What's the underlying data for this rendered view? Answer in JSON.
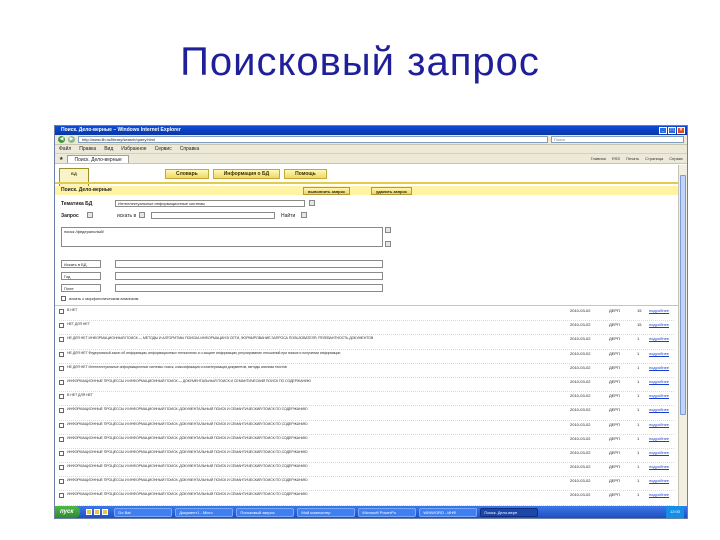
{
  "slide_title": "Поисковый запрос",
  "browser": {
    "title": "Поиск. Дело-верные – Windows Internet Explorer",
    "address": "http://www.lib.ru/library/search/query.html",
    "search_placeholder": "Поиск",
    "menu": [
      "Файл",
      "Правка",
      "Вид",
      "Избранное",
      "Сервис",
      "Справка"
    ],
    "tab_label": "Поиск. Дело-верные",
    "fav_tools": [
      "Главная",
      "RSS",
      "Печать",
      "Страница",
      "Сервис"
    ]
  },
  "site": {
    "logo_text": "БД",
    "nav": [
      "Словарь",
      "Информация о БД",
      "Помощь"
    ],
    "query_title": "Поиск. Дело-верные",
    "btn_run": "выполнить запрос",
    "btn_clear": "удалить запрос",
    "label_theme": "Тематика БД",
    "theme_value": "Интеллектуальные информационные системы",
    "label_query": "Запрос",
    "label_near": "искать в",
    "label_count": "Найти",
    "query_text": "поиск /федеральный/",
    "filters": [
      "Искать в БД",
      "Год",
      "Поле"
    ],
    "morph_label": "искать с морфологическим анализом"
  },
  "results": [
    {
      "text": "В НЕТ",
      "date": "2010-03-02",
      "code": "ДЕРП",
      "num": "15",
      "link": "подробнее"
    },
    {
      "text": "НЕТ ДЛЯ НЕТ",
      "date": "2010-03-02",
      "code": "ДЕРП",
      "num": "15",
      "link": "подробнее"
    },
    {
      "text": "НЕ ДЛЯ НЕТ ИНФОРМАЦИОННЫЙ ПОИСК — МЕТОДЫ И АЛГОРИТМЫ ПОИСКА ИНФОРМАЦИИ В СЕТИ, ФОРМИРОВАНИЕ ЗАПРОСА ПОЛЬЗОВАТЕЛЯ, РЕЛЕВАНТНОСТЬ ДОКУМЕНТОВ",
      "date": "2010-03-02",
      "code": "ДЕРП",
      "num": "1",
      "link": "подробнее"
    },
    {
      "text": "НЕ ДЛЯ НЕТ Федеральный закон об информации, информационных технологиях и о защите информации; регулирование отношений при поиске и получении информации",
      "date": "2010-03-02",
      "code": "ДЕРП",
      "num": "1",
      "link": "подробнее"
    },
    {
      "text": "НЕ ДЛЯ НЕТ Интеллектуальные информационные системы: поиск, классификация и кластеризация документов, методы анализа текстов",
      "date": "2010-03-02",
      "code": "ДЕРП",
      "num": "1",
      "link": "подробнее"
    },
    {
      "text": "ИНФОРМАЦИОННЫЕ ПРОЦЕССЫ И ИНФОРМАЦИОННЫЙ ПОИСК — ДОКУМЕНТАЛЬНЫЙ ПОИСК И СЕМАНТИЧЕСКИЙ ПОИСК ПО СОДЕРЖАНИЮ",
      "date": "2010-03-02",
      "code": "ДЕРП",
      "num": "1",
      "link": "подробнее"
    },
    {
      "text": "В НЕТ ДЛЯ НЕТ",
      "date": "2010-03-02",
      "code": "ДЕРП",
      "num": "1",
      "link": "подробнее"
    },
    {
      "text": "ИНФОРМАЦИОННЫЕ ПРОЦЕССЫ И ИНФОРМАЦИОННЫЙ ПОИСК: ДОКУМЕНТАЛЬНЫЙ ПОИСК И СЕМАНТИЧЕСКИЙ ПОИСК ПО СОДЕРЖАНИЮ",
      "date": "2010-03-02",
      "code": "ДЕРП",
      "num": "1",
      "link": "подробнее"
    },
    {
      "text": "ИНФОРМАЦИОННЫЕ ПРОЦЕССЫ И ИНФОРМАЦИОННЫЙ ПОИСК: ДОКУМЕНТАЛЬНЫЙ ПОИСК И СЕМАНТИЧЕСКИЙ ПОИСК ПО СОДЕРЖАНИЮ",
      "date": "2010-03-02",
      "code": "ДЕРП",
      "num": "1",
      "link": "подробнее"
    },
    {
      "text": "ИНФОРМАЦИОННЫЕ ПРОЦЕССЫ И ИНФОРМАЦИОННЫЙ ПОИСК: ДОКУМЕНТАЛЬНЫЙ ПОИСК И СЕМАНТИЧЕСКИЙ ПОИСК ПО СОДЕРЖАНИЮ",
      "date": "2010-03-02",
      "code": "ДЕРП",
      "num": "1",
      "link": "подробнее"
    },
    {
      "text": "ИНФОРМАЦИОННЫЕ ПРОЦЕССЫ И ИНФОРМАЦИОННЫЙ ПОИСК: ДОКУМЕНТАЛЬНЫЙ ПОИСК И СЕМАНТИЧЕСКИЙ ПОИСК ПО СОДЕРЖАНИЮ",
      "date": "2010-03-02",
      "code": "ДЕРП",
      "num": "1",
      "link": "подробнее"
    },
    {
      "text": "ИНФОРМАЦИОННЫЕ ПРОЦЕССЫ И ИНФОРМАЦИОННЫЙ ПОИСК: ДОКУМЕНТАЛЬНЫЙ ПОИСК И СЕМАНТИЧЕСКИЙ ПОИСК ПО СОДЕРЖАНИЮ",
      "date": "2010-03-02",
      "code": "ДЕРП",
      "num": "1",
      "link": "подробнее"
    },
    {
      "text": "ИНФОРМАЦИОННЫЕ ПРОЦЕССЫ И ИНФОРМАЦИОННЫЙ ПОИСК: ДОКУМЕНТАЛЬНЫЙ ПОИСК И СЕМАНТИЧЕСКИЙ ПОИСК ПО СОДЕРЖАНИЮ",
      "date": "2010-03-02",
      "code": "ДЕРП",
      "num": "1",
      "link": "подробнее"
    },
    {
      "text": "ИНФОРМАЦИОННЫЕ ПРОЦЕССЫ И ИНФОРМАЦИОННЫЙ ПОИСК: ДОКУМЕНТАЛЬНЫЙ ПОИСК И СЕМАНТИЧЕСКИЙ ПОИСК ПО СОДЕРЖАНИЮ",
      "date": "2010-03-02",
      "code": "ДЕРП",
      "num": "1",
      "link": "подробнее"
    }
  ],
  "taskbar": {
    "start": "пуск",
    "tasks": [
      "Do Bat",
      "Документ1 - Micro",
      "Поисковый запрос",
      "Мой компьютер",
      "Microsoft PowerPo",
      "WINWORD - ИНФ",
      "Поиск. Дело-верн"
    ],
    "clock": "12:00"
  }
}
